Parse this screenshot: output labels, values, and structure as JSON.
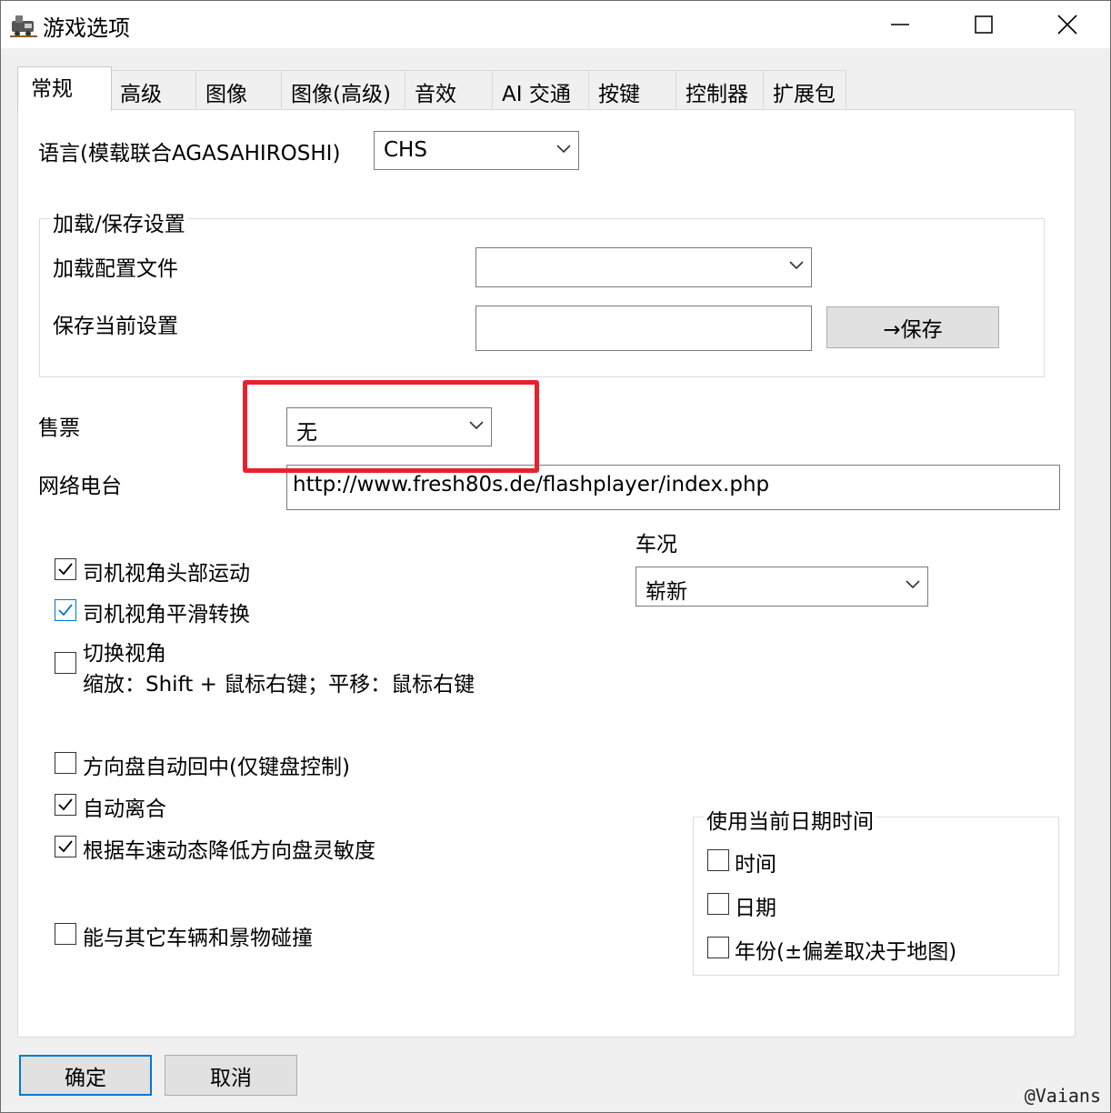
{
  "window": {
    "title": "游戏选项"
  },
  "tabs": [
    "常规",
    "高级",
    "图像",
    "图像(高级)",
    "音效",
    "AI 交通",
    "按键",
    "控制器",
    "扩展包"
  ],
  "general": {
    "language_label": "语言(模载联合AGASAHIROSHI)",
    "language_value": "CHS",
    "load_save_group": {
      "title": "加载/保存设置",
      "load_profile_label": "加载配置文件",
      "load_profile_value": "",
      "save_current_label": "保存当前设置",
      "save_current_value": "",
      "save_button": "→保存"
    },
    "ticket_label": "售票",
    "ticket_value": "无",
    "radio_label": "网络电台",
    "radio_value": "http://www.fresh80s.de/flashplayer/index.php",
    "condition_label": "车况",
    "condition_value": "崭新",
    "checkboxes": [
      {
        "label": "司机视角头部运动",
        "checked": true
      },
      {
        "label": "司机视角平滑转换",
        "checked": true
      },
      {
        "label": "切换视角",
        "sub": "缩放：Shift + 鼠标右键；平移：鼠标右键",
        "checked": false
      },
      {
        "label": "方向盘自动回中(仅键盘控制)",
        "checked": false
      },
      {
        "label": "自动离合",
        "checked": true
      },
      {
        "label": "根据车速动态降低方向盘灵敏度",
        "checked": true
      },
      {
        "label": "能与其它车辆和景物碰撞",
        "checked": false
      }
    ],
    "datetime_group": {
      "title": "使用当前日期时间",
      "items": [
        {
          "label": "时间",
          "checked": false
        },
        {
          "label": "日期",
          "checked": false
        },
        {
          "label": "年份(±偏差取决于地图)",
          "checked": false
        }
      ]
    }
  },
  "footer": {
    "ok_button": "确定",
    "cancel_button": "取消"
  },
  "watermark": "@Vaians",
  "colors": {
    "highlight_box": "#e8212e",
    "focus_accent": "#0078d7"
  }
}
